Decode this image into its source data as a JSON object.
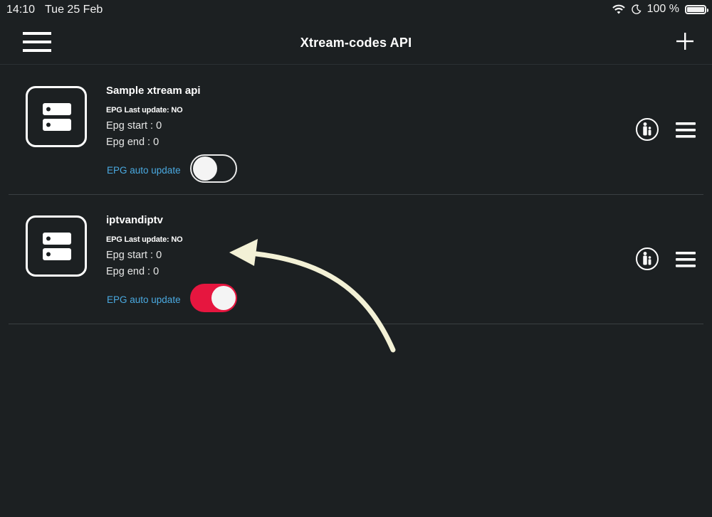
{
  "status_bar": {
    "time": "14:10",
    "date": "Tue 25 Feb",
    "battery": "100 %",
    "battery_level": 1.0,
    "icons": [
      "wifi-icon",
      "moon-icon",
      "battery-icon"
    ]
  },
  "nav": {
    "title": "Xtream-codes API",
    "left_icon": "hamburger-menu-icon",
    "right_icon": "plus-icon"
  },
  "rows": [
    {
      "title": "Sample xtream api",
      "epg_last_update": "EPG Last update: NO",
      "epg_start": "Epg start : 0",
      "epg_end": "Epg end : 0",
      "auto_update_label": "EPG auto update",
      "auto_update_on": false
    },
    {
      "title": "iptvandiptv",
      "epg_last_update": "EPG Last update: NO",
      "epg_start": "Epg start : 0",
      "epg_end": "Epg end : 0",
      "auto_update_label": "EPG auto update",
      "auto_update_on": true
    }
  ],
  "colors": {
    "background": "#1c2022",
    "accent_link": "#4aa9e0",
    "toggle_on": "#e6163f",
    "annotation_arrow": "#f3f1d6"
  }
}
